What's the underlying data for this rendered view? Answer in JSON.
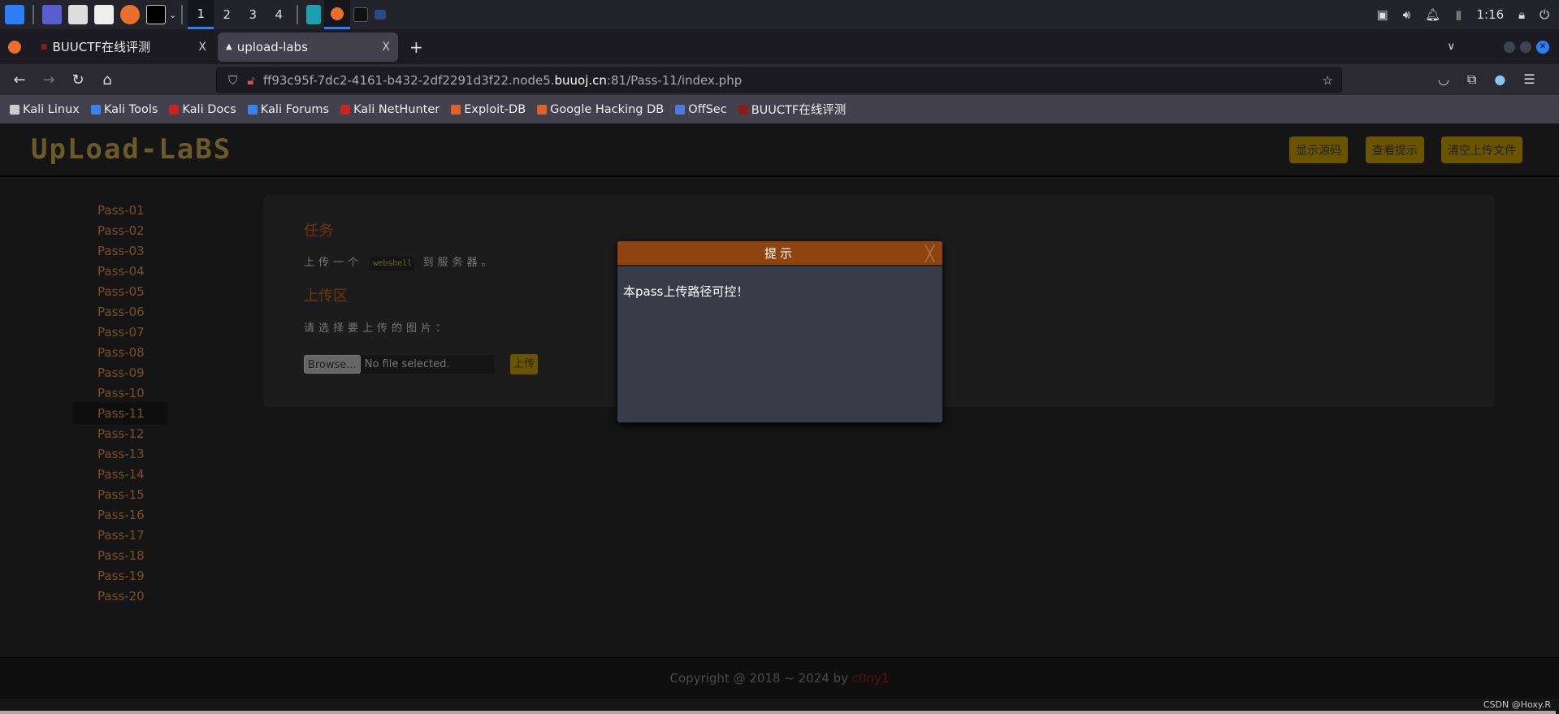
{
  "taskbar": {
    "workspaces": [
      "1",
      "2",
      "3",
      "4"
    ],
    "active_workspace": "1",
    "clock": "1:16"
  },
  "tabs": [
    {
      "label": "BUUCTF在线评测",
      "close": "X"
    },
    {
      "label": "upload-labs",
      "close": "X",
      "selected": true
    }
  ],
  "new_tab": "+",
  "url": {
    "prefix": "ff93c95f-7dc2-4161-b432-2df2291d3f22.node5.",
    "domain": "buuoj.cn",
    "suffix": ":81/Pass-11/index.php"
  },
  "bookmarks": [
    {
      "label": "Kali Linux",
      "color": "#cccccc"
    },
    {
      "label": "Kali Tools",
      "color": "#3b82f6"
    },
    {
      "label": "Kali Docs",
      "color": "#cc2222"
    },
    {
      "label": "Kali Forums",
      "color": "#3b82f6"
    },
    {
      "label": "Kali NetHunter",
      "color": "#cc2222"
    },
    {
      "label": "Exploit-DB",
      "color": "#e0602a"
    },
    {
      "label": "Google Hacking DB",
      "color": "#e0602a"
    },
    {
      "label": "OffSec",
      "color": "#4a7bd8"
    },
    {
      "label": "BUUCTF在线评测",
      "color": "#8b1a1a"
    }
  ],
  "header": {
    "logo": "UpLoad-LaBS",
    "buttons": [
      "显示源码",
      "查看提示",
      "清空上传文件"
    ]
  },
  "sidebar": {
    "items": [
      "Pass-01",
      "Pass-02",
      "Pass-03",
      "Pass-04",
      "Pass-05",
      "Pass-06",
      "Pass-07",
      "Pass-08",
      "Pass-09",
      "Pass-10",
      "Pass-11",
      "Pass-12",
      "Pass-13",
      "Pass-14",
      "Pass-15",
      "Pass-16",
      "Pass-17",
      "Pass-18",
      "Pass-19",
      "Pass-20"
    ],
    "active": "Pass-11"
  },
  "main": {
    "task_title": "任务",
    "task_pre": "上传一个",
    "task_code": "webshell",
    "task_post": "到服务器。",
    "upload_title": "上传区",
    "upload_prompt": "请选择要上传的图片：",
    "browse": "Browse...",
    "file_status": "No file selected.",
    "upload_button": "上传"
  },
  "modal": {
    "title": "提示",
    "close": "╳",
    "message": "本pass上传路径可控！"
  },
  "footer": {
    "text": "Copyright @ 2018 ~ 2024 by ",
    "author": "c0ny1"
  },
  "watermark": "CSDN @Hoxy.R",
  "colors": {
    "accent": "#8f4410",
    "button": "#6b5400"
  }
}
